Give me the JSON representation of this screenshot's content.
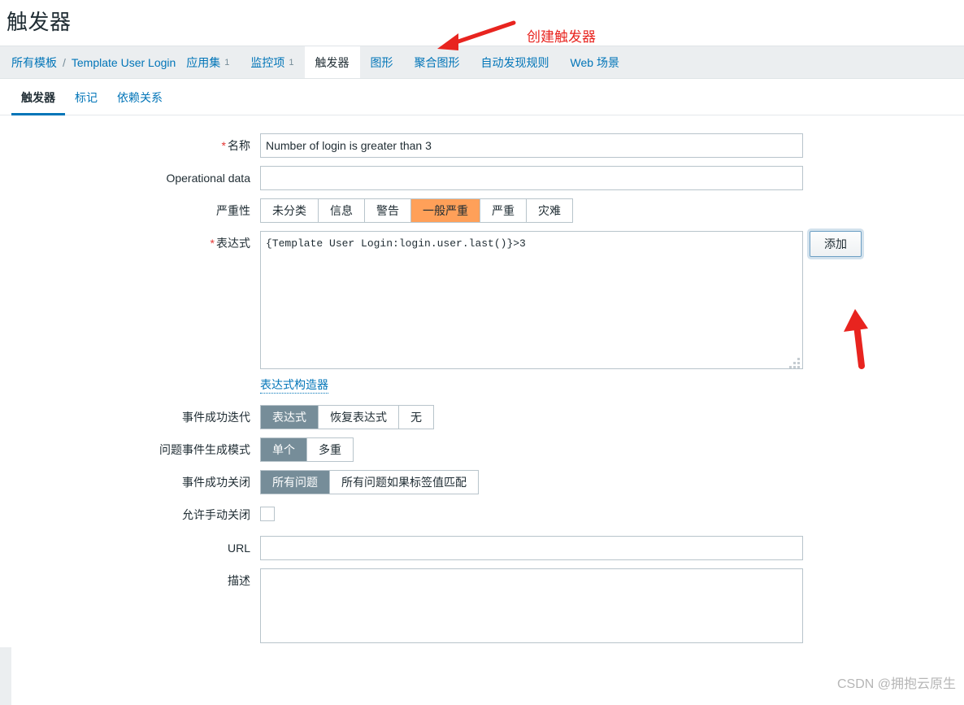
{
  "page": {
    "title": "触发器"
  },
  "breadcrumb": {
    "root_label": "所有模板",
    "separator": "/",
    "template_label": "Template User Login",
    "items": [
      {
        "label": "应用集",
        "count": "1",
        "active": false
      },
      {
        "label": "监控项",
        "count": "1",
        "active": false
      },
      {
        "label": "触发器",
        "count": "",
        "active": true
      },
      {
        "label": "图形",
        "count": "",
        "active": false
      },
      {
        "label": "聚合图形",
        "count": "",
        "active": false
      },
      {
        "label": "自动发现规则",
        "count": "",
        "active": false
      },
      {
        "label": "Web 场景",
        "count": "",
        "active": false
      }
    ]
  },
  "subtabs": [
    {
      "label": "触发器",
      "active": true
    },
    {
      "label": "标记",
      "active": false
    },
    {
      "label": "依赖关系",
      "active": false
    }
  ],
  "form": {
    "name": {
      "label": "名称",
      "required": true,
      "value": "Number of login is greater than 3",
      "placeholder": ""
    },
    "operational_data": {
      "label": "Operational data",
      "required": false,
      "value": "",
      "placeholder": ""
    },
    "severity": {
      "label": "严重性",
      "options": [
        "未分类",
        "信息",
        "警告",
        "一般严重",
        "严重",
        "灾难"
      ],
      "selected": "一般严重"
    },
    "expression": {
      "label": "表达式",
      "required": true,
      "value": "{Template User Login:login.user.last()}>3",
      "add_button": "添加",
      "builder_link": "表达式构造器"
    },
    "event_success_iteration": {
      "label": "事件成功迭代",
      "options": [
        "表达式",
        "恢复表达式",
        "无"
      ],
      "selected": "表达式"
    },
    "problem_event_generation_mode": {
      "label": "问题事件生成模式",
      "options": [
        "单个",
        "多重"
      ],
      "selected": "单个"
    },
    "event_success_close": {
      "label": "事件成功关闭",
      "options": [
        "所有问题",
        "所有问题如果标签值匹配"
      ],
      "selected": "所有问题"
    },
    "allow_manual_close": {
      "label": "允许手动关闭",
      "checked": false
    },
    "url": {
      "label": "URL",
      "value": "",
      "placeholder": ""
    },
    "description": {
      "label": "描述",
      "value": "",
      "placeholder": ""
    }
  },
  "annotations": {
    "create_trigger": "创建触发器"
  },
  "watermark": {
    "text": "CSDN @拥抱云原生"
  },
  "colors": {
    "accent_blue": "#0275b8",
    "selected_gray": "#768d99",
    "severity_orange": "#ffa059",
    "annotation_red": "#e8241f",
    "required_red": "#e33734"
  }
}
